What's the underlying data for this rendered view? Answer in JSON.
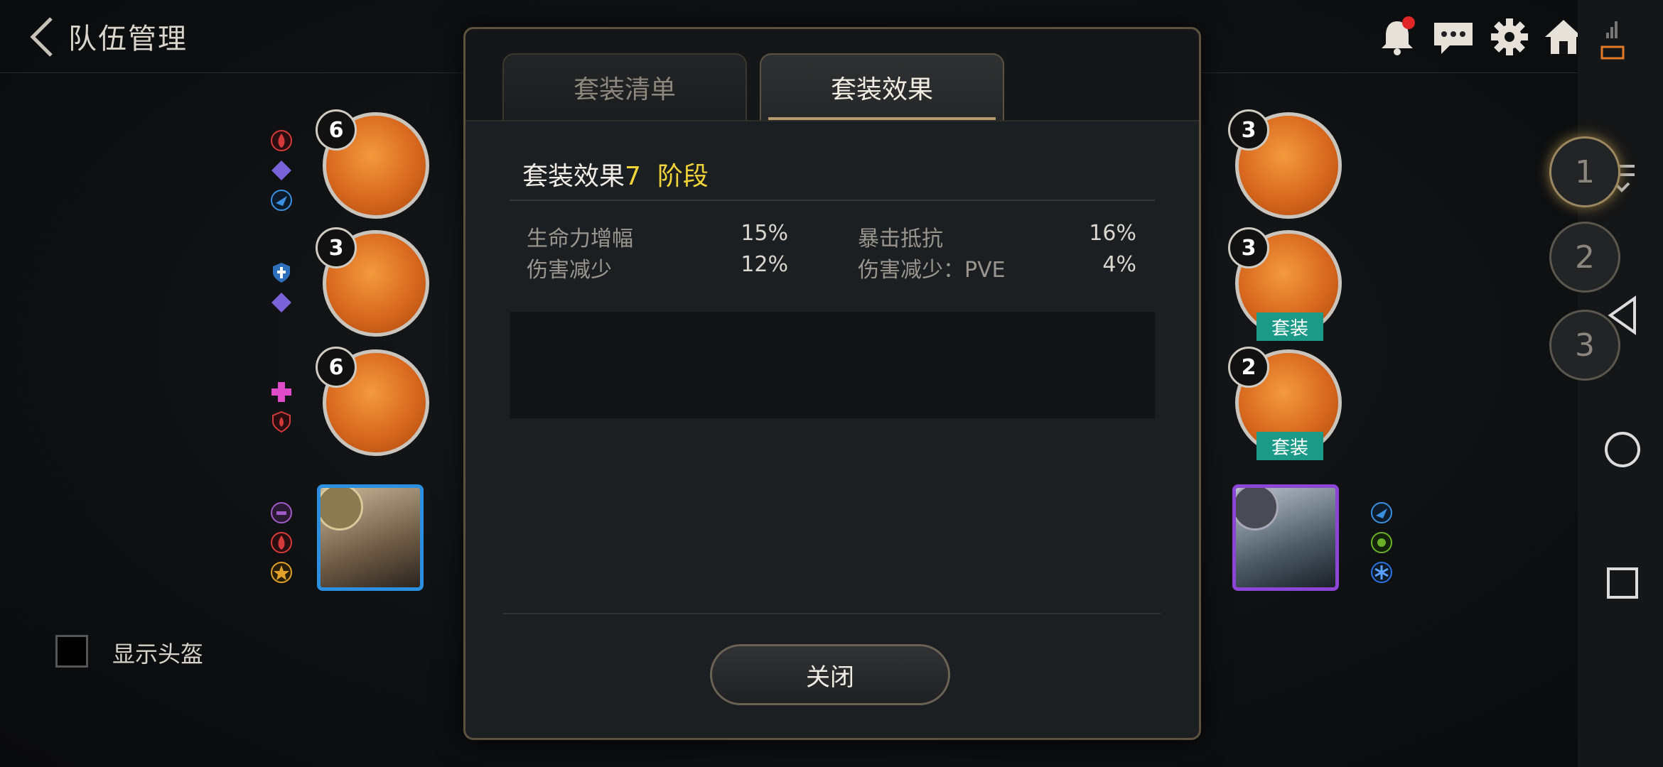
{
  "header": {
    "title": "队伍管理"
  },
  "modal": {
    "tabs": [
      {
        "label": "套装清单",
        "active": false
      },
      {
        "label": "套装效果",
        "active": true
      }
    ],
    "effect_title_prefix": "套装效果",
    "effect_level": "7",
    "effect_stage": "阶段",
    "stats": [
      {
        "name": "生命力增幅",
        "value": "15%"
      },
      {
        "name": "暴击抵抗",
        "value": "16%"
      },
      {
        "name": "伤害减少",
        "value": "12%"
      },
      {
        "name": "伤害减少：PVE",
        "value": "4%"
      }
    ],
    "close_label": "关闭"
  },
  "left_slots": [
    {
      "level": "6"
    },
    {
      "level": "3"
    },
    {
      "level": "6"
    }
  ],
  "right_slots": [
    {
      "level": "3",
      "set_tag": ""
    },
    {
      "level": "3",
      "set_tag": "套装"
    },
    {
      "level": "2",
      "set_tag": "套装"
    }
  ],
  "show_helmet_label": "显示头盔",
  "team_buttons": [
    "1",
    "2",
    "3"
  ],
  "colors": {
    "accent_gold": "#f1d33a",
    "set_tag": "#1b9a88",
    "gear_orange": "#d8681e"
  }
}
